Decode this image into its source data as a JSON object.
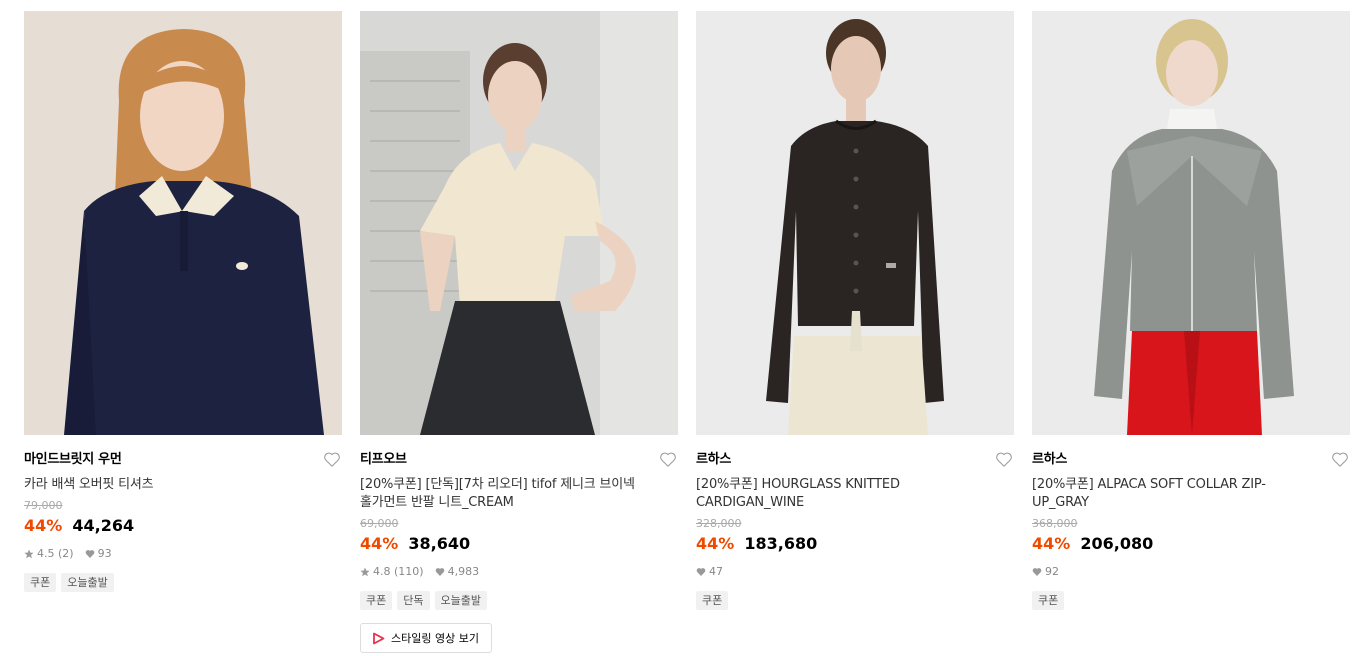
{
  "products": [
    {
      "brand": "마인드브릿지 우먼",
      "name": "카라 배색 오버핏 티셔츠",
      "original_price": "79,000",
      "discount": "44%",
      "price": "44,264",
      "rating": "4.5",
      "review_count": "(2)",
      "likes": "93",
      "tags": [
        "쿠폰",
        "오늘출발"
      ]
    },
    {
      "brand": "티프오브",
      "name": "[20%쿠폰] [단독][7차 리오더] tifof 제니크 브이넥 홀가먼트 반팔 니트_CREAM",
      "original_price": "69,000",
      "discount": "44%",
      "price": "38,640",
      "rating": "4.8",
      "review_count": "(110)",
      "likes": "4,983",
      "tags": [
        "쿠폰",
        "단독",
        "오늘출발"
      ],
      "video_label": "스타일링 영상 보기"
    },
    {
      "brand": "르하스",
      "name": "[20%쿠폰] HOURGLASS KNITTED CARDIGAN_WINE",
      "original_price": "328,000",
      "discount": "44%",
      "price": "183,680",
      "likes": "47",
      "tags": [
        "쿠폰"
      ]
    },
    {
      "brand": "르하스",
      "name": "[20%쿠폰] ALPACA SOFT COLLAR ZIP-UP_GRAY",
      "original_price": "368,000",
      "discount": "44%",
      "price": "206,080",
      "likes": "92",
      "tags": [
        "쿠폰"
      ]
    }
  ],
  "colors": {
    "discount": "#f04a00",
    "tag_bg": "#f1f1f1",
    "video_icon": "#e8344e"
  },
  "icons": {
    "wishlist": "heart-outline-icon",
    "rating": "star-icon",
    "likes": "heart-filled-icon",
    "video": "play-icon"
  }
}
